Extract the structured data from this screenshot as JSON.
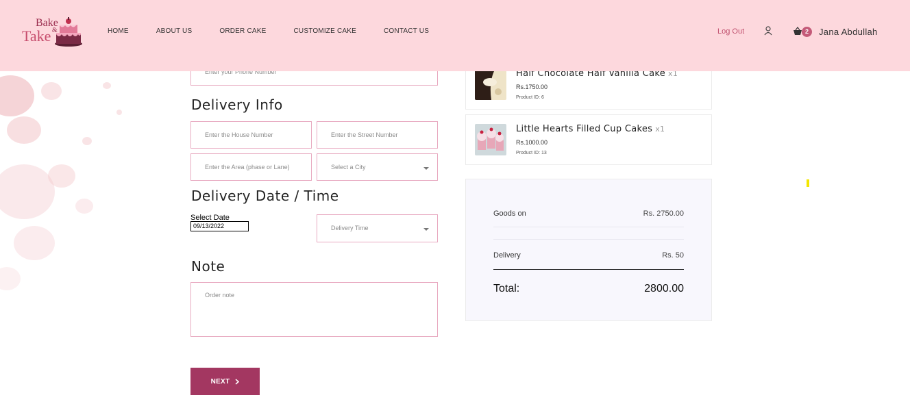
{
  "header": {
    "logo": {
      "word1": "Bake",
      "amp": "&",
      "word2": "Take"
    },
    "nav": [
      {
        "label": "HOME"
      },
      {
        "label": "ABOUT US"
      },
      {
        "label": "ORDER CAKE"
      },
      {
        "label": "CUSTOMIZE CAKE"
      },
      {
        "label": "CONTACT US"
      }
    ],
    "logout_label": "Log Out",
    "cart_count": "2",
    "username": "Jana Abdullah"
  },
  "form": {
    "phone_placeholder": "Enter your Phone Number",
    "delivery_info_title": "Delivery Info",
    "house_placeholder": "Enter the House Number",
    "street_placeholder": "Enter the Street Number",
    "area_placeholder": "Enter the Area (phase or Lane)",
    "city_placeholder": "Select a City",
    "delivery_datetime_title": "Delivery Date / Time",
    "date_label": "Select Date",
    "date_value": "09/13/2022",
    "time_placeholder": "Delivery Time",
    "note_title": "Note",
    "note_placeholder": "Order note",
    "next_label": "NEXT"
  },
  "cart": {
    "items": [
      {
        "name": "Half Chocolate Half Vanilla Cake",
        "qty": "x1",
        "price": "Rs.1750.00",
        "product_id": "Product ID: 6"
      },
      {
        "name": "Little Hearts Filled Cup Cakes",
        "qty": "x1",
        "price": "Rs.1000.00",
        "product_id": "Product ID: 13"
      }
    ],
    "summary": {
      "goods_label": "Goods on",
      "goods_value": "Rs. 2750.00",
      "delivery_label": "Delivery",
      "delivery_value": "Rs. 50",
      "total_label": "Total:",
      "total_value": "2800.00"
    }
  },
  "colors": {
    "header_bg": "#fdd8dd",
    "accent": "#a33761",
    "field_border": "#e8a9c0",
    "summary_bg": "#f8f7fd"
  }
}
